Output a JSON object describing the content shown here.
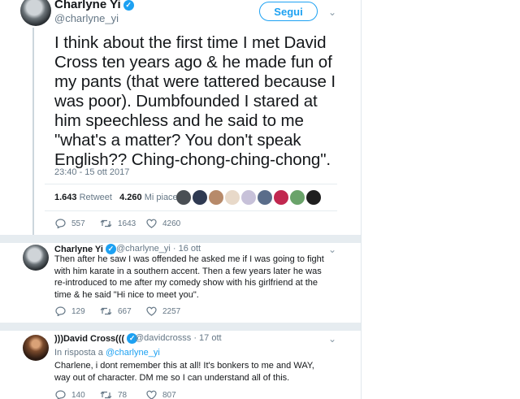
{
  "main_tweet": {
    "author_name": "Charlyne Yi",
    "handle": "@charlyne_yi",
    "follow_label": "Segui",
    "text": "I think about the first time I met David Cross ten years ago & he made fun of my pants (that were tattered because I was poor). Dumbfounded I stared at him speechless and he said to me \"what's a matter? You don't speak English?? Ching-chong-ching-chong\".",
    "timestamp": "23:40 - 15 ott 2017",
    "retweets_count": "1.643",
    "retweets_label": "Retweet",
    "likes_count": "4.260",
    "likes_label": "Mi piace",
    "reply_count": "557",
    "retweet_count": "1643",
    "like_count": "4260",
    "likers": [
      "#4a4f54",
      "#2f3a52",
      "#b78a6a",
      "#e8d9c9",
      "#c7c1d9",
      "#5a6d8a",
      "#c1274f",
      "#6aa36a",
      "#1f1f1f"
    ]
  },
  "reply1": {
    "author_name": "Charlyne Yi",
    "handle": "@charlyne_yi",
    "time": "· 16 ott",
    "text": "Then after he saw I was offended he asked me if I was going to fight with him karate in a southern accent. Then a few years later he was re-introduced to me after my comedy show with his girlfriend at the time & he said \"Hi nice to meet you\".",
    "reply_count": "129",
    "retweet_count": "667",
    "like_count": "2257"
  },
  "reply2": {
    "author_name": ")))David Cross(((",
    "handle": "@davidcrosss",
    "time": "· 17 ott",
    "in_reply_prefix": "In risposta a",
    "in_reply_handle": "@charlyne_yi",
    "text": "Charlene, i dont remember this at all! It's bonkers to me and WAY, way out of character. DM me so I can understand all of this.",
    "reply_count": "140",
    "retweet_count": "78",
    "like_count": "807"
  },
  "icons": {
    "verified": "verified-badge-icon",
    "reply": "reply-icon",
    "retweet": "retweet-icon",
    "like": "heart-icon",
    "menu": "chevron-down-icon"
  },
  "colors": {
    "accent": "#1da1f2",
    "muted": "#657786",
    "text": "#14171a",
    "separator": "#e6ecf0"
  }
}
